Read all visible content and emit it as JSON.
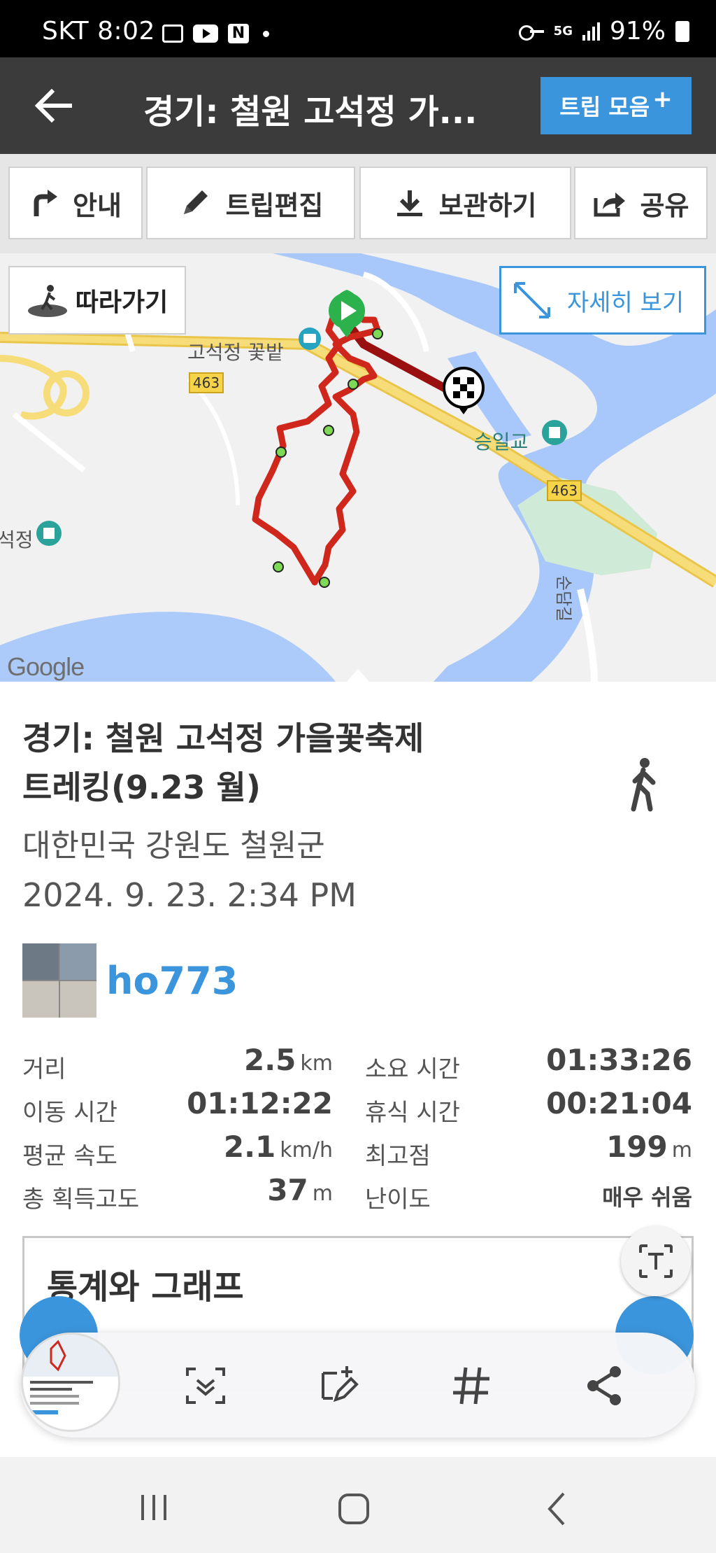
{
  "status_bar": {
    "carrier_time": "SKT 8:02",
    "network": "5G",
    "battery": "91%"
  },
  "app_bar": {
    "title": "경기: 철원 고석정 가...",
    "trip_collection_label": "트립 모음",
    "trip_collection_plus": "+"
  },
  "actions": [
    {
      "label": "안내",
      "icon": "turn-right-icon"
    },
    {
      "label": "트립편집",
      "icon": "pencil-icon"
    },
    {
      "label": "보관하기",
      "icon": "download-icon"
    },
    {
      "label": "공유",
      "icon": "share-icon"
    }
  ],
  "map": {
    "follow_label": "따라가기",
    "detail_label": "자세히 보기",
    "labels": {
      "flower_field": "고석정 꽃밭",
      "bridge": "승일교",
      "left_place": "석정",
      "road_vertical": "순담길",
      "route_no": "463"
    },
    "google": "Google"
  },
  "trip": {
    "title_line1": "경기: 철원 고석정 가을꽃축제",
    "title_line2": "트레킹(9.23 월)",
    "location": "대한민국 강원도 철원군",
    "date": "2024. 9. 23. 2:34 PM",
    "user": "ho773"
  },
  "stats": [
    {
      "label": "거리",
      "value": "2.5",
      "unit": "km",
      "label2": "소요 시간",
      "value2": "01:33:26",
      "unit2": ""
    },
    {
      "label": "이동 시간",
      "value": "01:12:22",
      "unit": "",
      "label2": "휴식 시간",
      "value2": "00:21:04",
      "unit2": ""
    },
    {
      "label": "평균 속도",
      "value": "2.1",
      "unit": "km/h",
      "label2": "최고점",
      "value2": "199",
      "unit2": "m"
    },
    {
      "label": "총 획득고도",
      "value": "37",
      "unit": "m",
      "label2": "난이도",
      "value2": "매우 쉬움",
      "unit2": ""
    }
  ],
  "graph_section": {
    "title": "통계와 그래프"
  }
}
